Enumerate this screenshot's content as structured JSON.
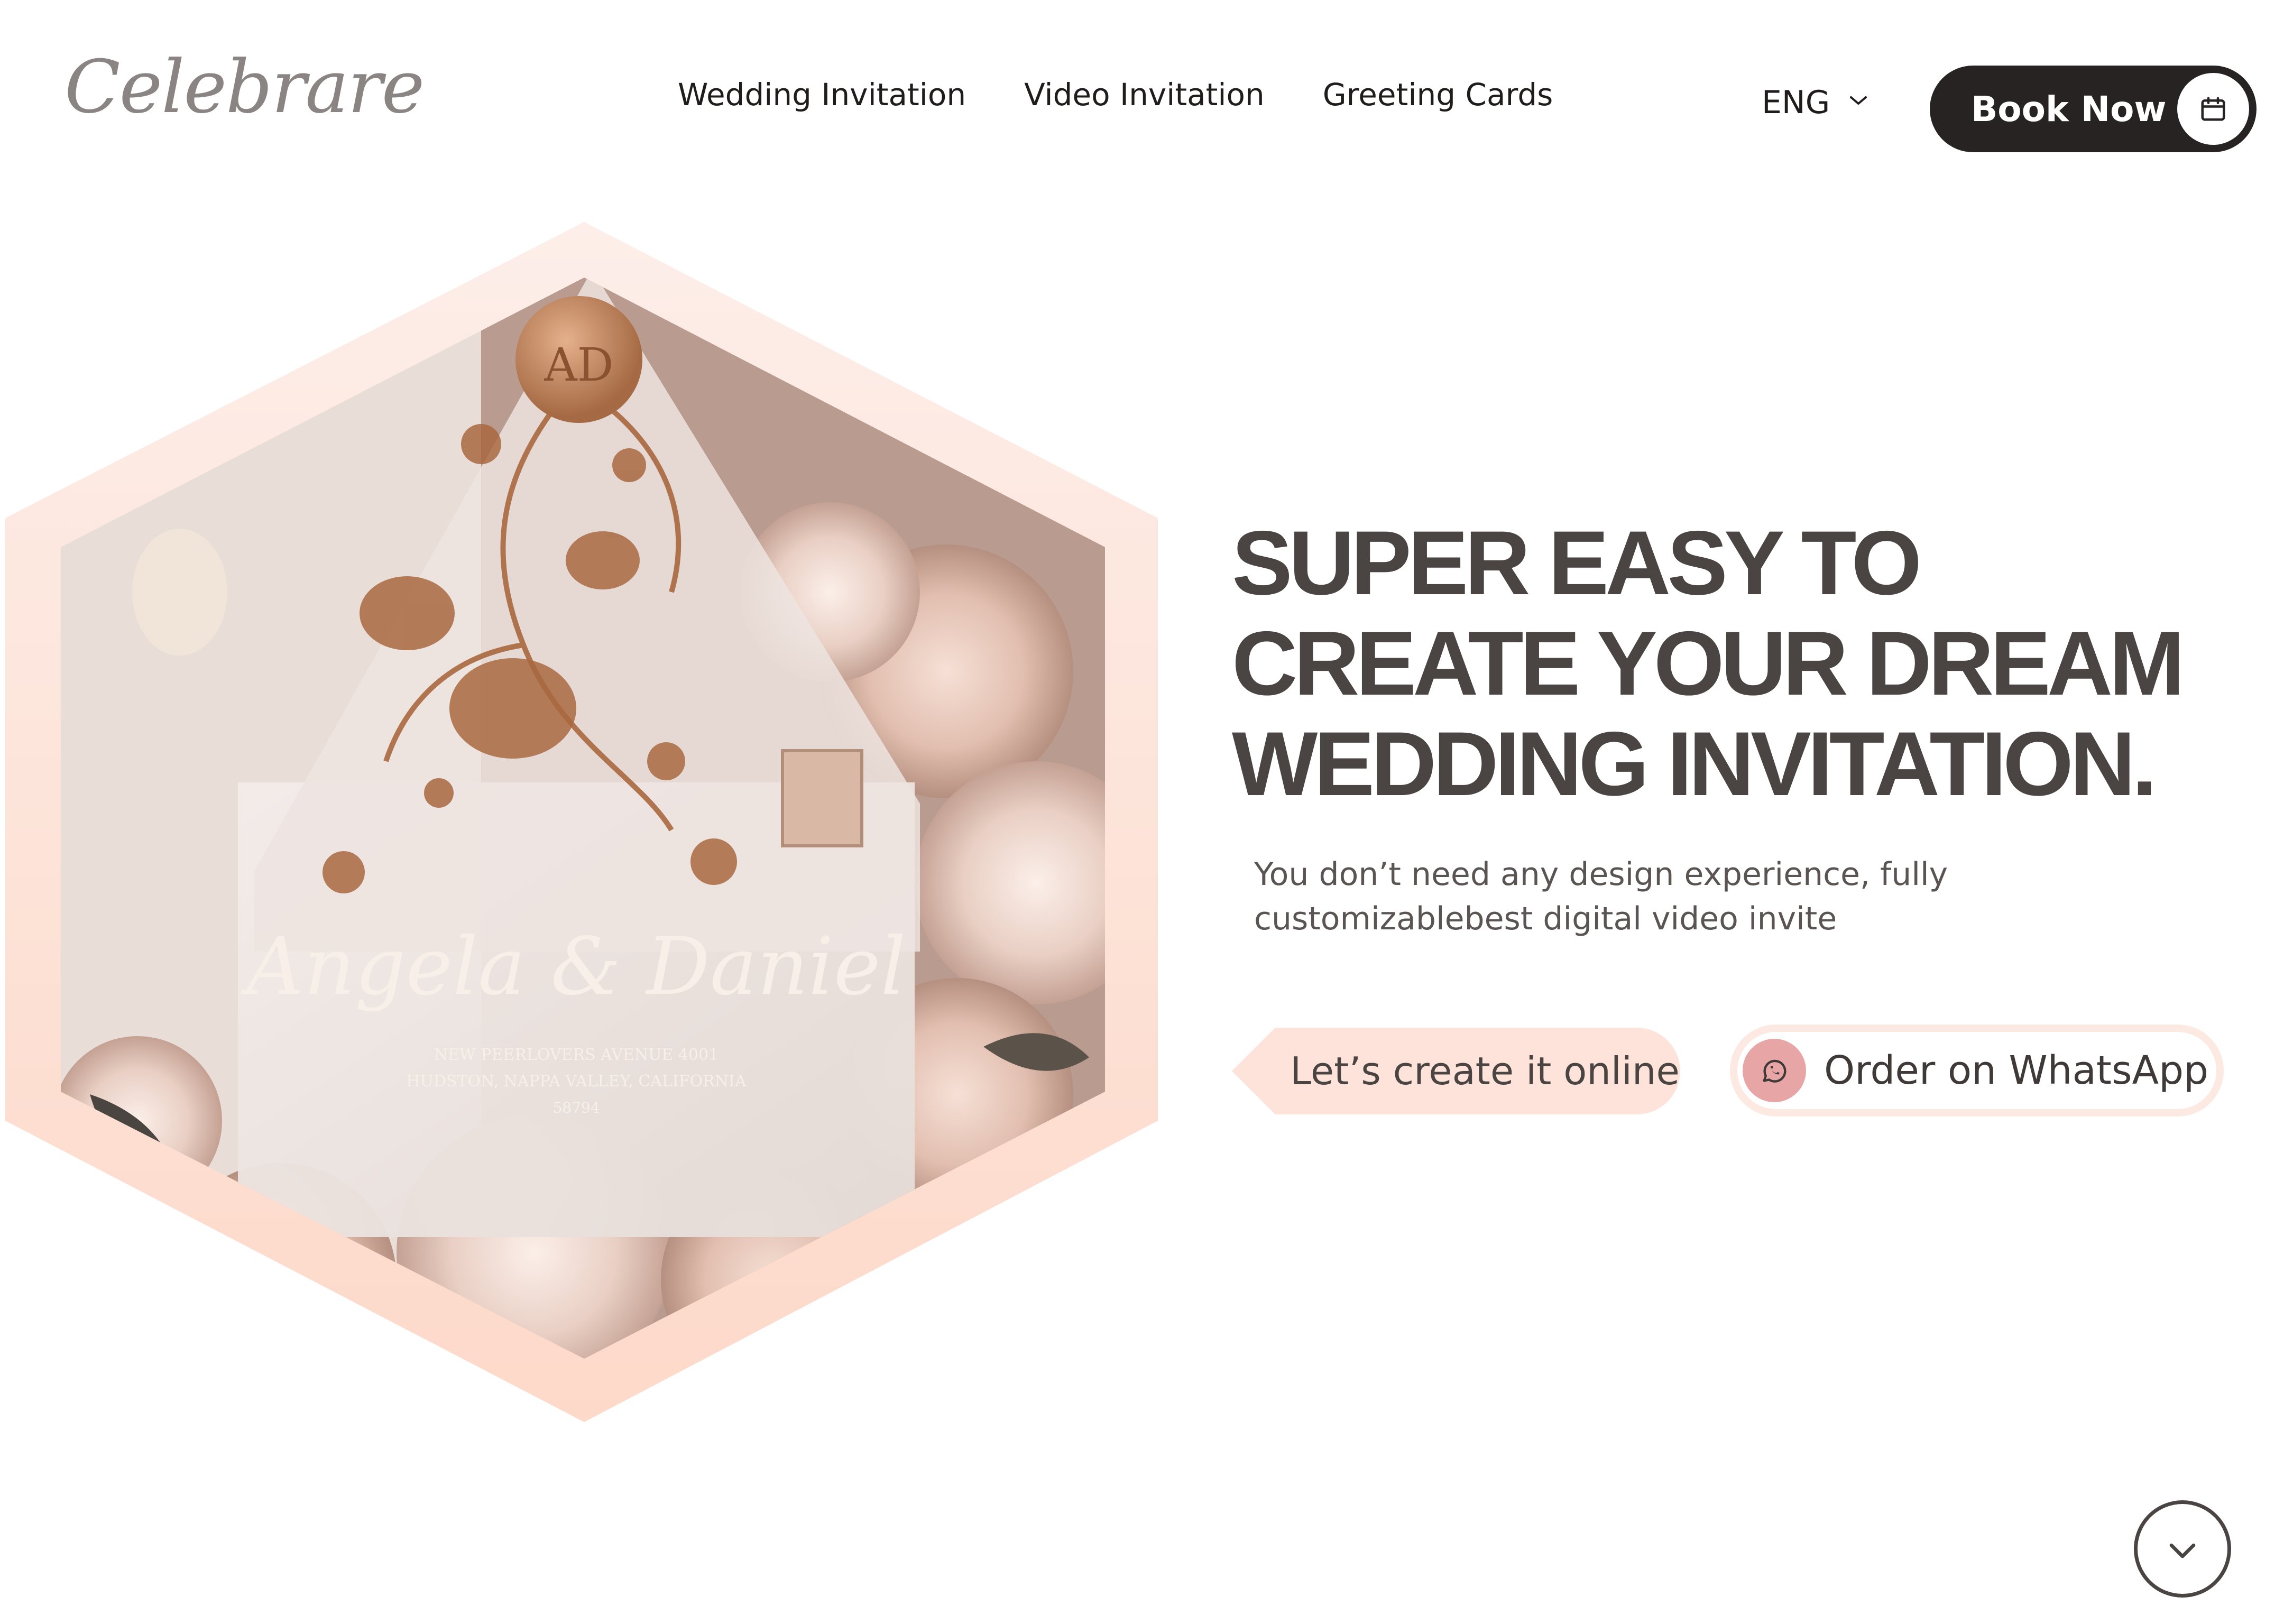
{
  "header": {
    "logo": "Celebrare",
    "nav": [
      {
        "label": "Wedding Invitation"
      },
      {
        "label": "Video Invitation"
      },
      {
        "label": "Greeting Cards"
      }
    ],
    "language": "ENG",
    "book_now": "Book Now"
  },
  "hero": {
    "headline": "SUPER EASY TO CREATE YOUR DREAM WEDDING INVITATION.",
    "subtext": "You don’t need any design experience, fully customizablebest digital video invite",
    "cta_create": "Let’s create it online",
    "cta_whatsapp": "Order on WhatsApp",
    "image": {
      "seal_text": "AD",
      "names": "Angela & Daniel",
      "address_line1": "NEW PEERLOVERS AVENUE 4001",
      "address_line2": "HUDSTON, NAPPA VALLEY, CALIFORNIA",
      "address_line3": "58794"
    }
  },
  "icons": {
    "language": "chevron-down-icon",
    "book_now": "calendar-icon",
    "whatsapp": "whatsapp-icon",
    "scroll": "chevron-down-icon"
  },
  "colors": {
    "primary_dark": "#272322",
    "headline": "#4a4442",
    "accent_peach": "#fde3da",
    "whatsapp_icon_bg": "#e8a5a6"
  }
}
